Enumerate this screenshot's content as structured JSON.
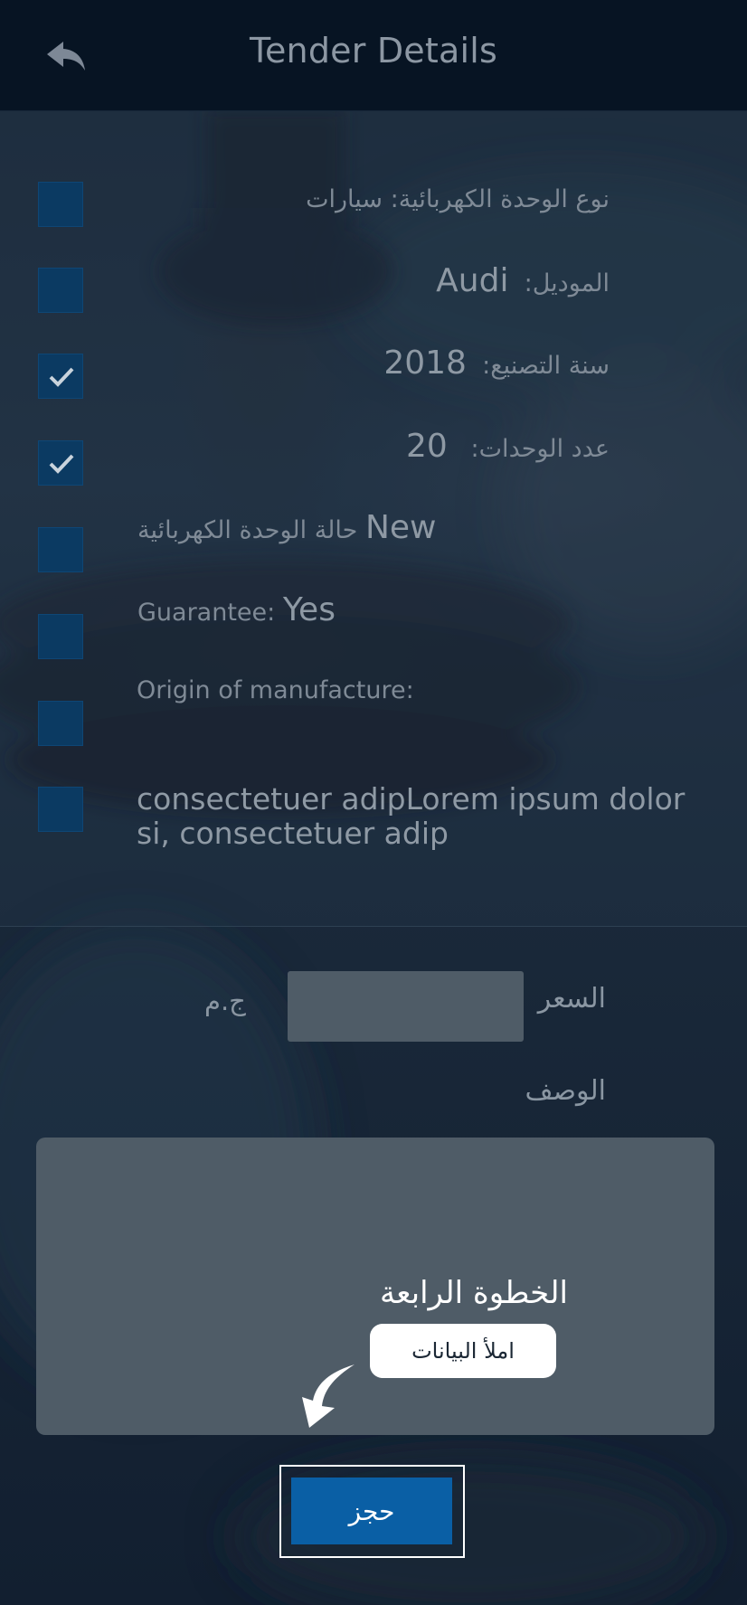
{
  "header": {
    "title": "Tender Details",
    "back_icon": "reply-arrow-icon"
  },
  "details": {
    "unit_type": {
      "label": "نوع الوحدة الكهربائية: سيارات",
      "checked": false
    },
    "model": {
      "label": "الموديل:",
      "value": "Audi",
      "checked": false
    },
    "year": {
      "label": "سنة التصنيع:",
      "value": "2018",
      "checked": true
    },
    "count": {
      "label": "عدد الوحدات:",
      "value": "20",
      "checked": true
    },
    "condition": {
      "label": "حالة الوحدة الكهربائية",
      "value": "New",
      "checked": false
    },
    "guarantee": {
      "label": "Guarantee:",
      "value": "Yes",
      "checked": false
    },
    "origin": {
      "label": "Origin of manufacture:",
      "checked": false
    },
    "description": {
      "text": "consectetuer adipLorem ipsum dolor si, consectetuer adip",
      "checked": false
    }
  },
  "form": {
    "price_label": "السعر",
    "currency": "ج.م",
    "price_value": "",
    "description_label": "الوصف",
    "description_value": ""
  },
  "overlay": {
    "step_title": "الخطوة الرابعة",
    "hint": "املأ البيانات",
    "arrow_icon": "curved-arrow-down-icon"
  },
  "submit": {
    "label": "حجز"
  },
  "colors": {
    "header_bg": "#071423",
    "checkbox": "#0b3a62",
    "button": "#0a5fa5",
    "field_bg": "#4f5c67"
  }
}
